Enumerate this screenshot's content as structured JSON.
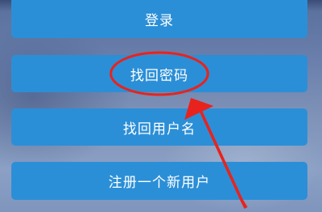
{
  "buttons": {
    "login": "登录",
    "find_password": "找回密码",
    "find_username": "找回用户名",
    "register": "注册一个新用户"
  },
  "annotation": {
    "color": "#e8231d",
    "target": "find_password"
  },
  "colors": {
    "button_bg": "#2b8fd7",
    "button_text": "#ffffff"
  }
}
